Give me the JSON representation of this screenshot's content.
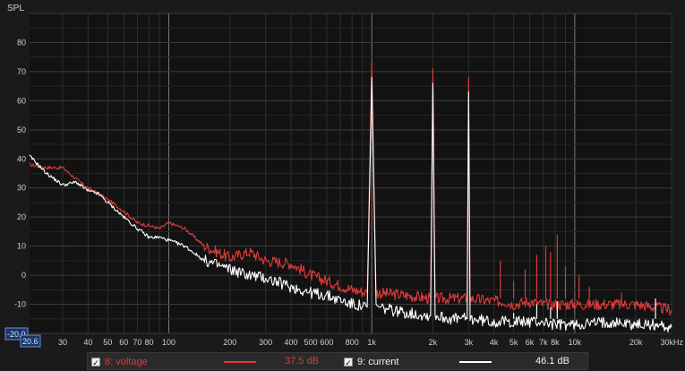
{
  "chart_data": {
    "type": "line",
    "ylabel": "SPL",
    "xlabel": "",
    "xscale": "log",
    "xlim": [
      20.6,
      30000
    ],
    "ylim": [
      -20,
      90
    ],
    "xaxis_min_label": "20.6",
    "yaxis_min_label": "-20.0",
    "ytick_labels": [
      "80",
      "70",
      "60",
      "50",
      "40",
      "30",
      "20",
      "10",
      "0",
      "-10"
    ],
    "yticks": [
      80,
      70,
      60,
      50,
      40,
      30,
      20,
      10,
      0,
      -10
    ],
    "xticks": [
      {
        "v": 30,
        "t": "30"
      },
      {
        "v": 40,
        "t": "40"
      },
      {
        "v": 50,
        "t": "50"
      },
      {
        "v": 60,
        "t": "60"
      },
      {
        "v": 70,
        "t": "70"
      },
      {
        "v": 80,
        "t": "80"
      },
      {
        "v": 100,
        "t": "100"
      },
      {
        "v": 200,
        "t": "200"
      },
      {
        "v": 300,
        "t": "300"
      },
      {
        "v": 400,
        "t": "400"
      },
      {
        "v": 500,
        "t": "500"
      },
      {
        "v": 600,
        "t": "600"
      },
      {
        "v": 800,
        "t": "800"
      },
      {
        "v": 1000,
        "t": "1k"
      },
      {
        "v": 2000,
        "t": "2k"
      },
      {
        "v": 3000,
        "t": "3k"
      },
      {
        "v": 4000,
        "t": "4k"
      },
      {
        "v": 5000,
        "t": "5k"
      },
      {
        "v": 6000,
        "t": "6k"
      },
      {
        "v": 7000,
        "t": "7k"
      },
      {
        "v": 8000,
        "t": "8k"
      },
      {
        "v": 10000,
        "t": "10k"
      },
      {
        "v": 20000,
        "t": "20k"
      },
      {
        "v": 30000,
        "t": "30kHz"
      }
    ],
    "grid": true,
    "legend_position": "bottom",
    "series": [
      {
        "name": "8: voltage",
        "color": "#e03a3a",
        "legend_value": "37.5 dB",
        "x": [
          20.6,
          25,
          30,
          35,
          40,
          45,
          50,
          60,
          70,
          80,
          90,
          100,
          120,
          150,
          200,
          250,
          300,
          400,
          500,
          600,
          800,
          950,
          1000,
          1050,
          1500,
          1950,
          2000,
          2050,
          2500,
          2950,
          3000,
          3050,
          4000,
          4500,
          5000,
          6000,
          7000,
          8000,
          10000,
          15000,
          20000,
          25000,
          30000
        ],
        "y": [
          38,
          37,
          37,
          33,
          30,
          28,
          26,
          22,
          18,
          17,
          16,
          18,
          16,
          10,
          6,
          8,
          5,
          4,
          0,
          -2,
          -5,
          -6,
          73,
          -6,
          -7,
          -8,
          71,
          -8,
          -8,
          -8,
          68,
          -8,
          -9,
          -9,
          -10,
          -9,
          -10,
          -10,
          -10,
          -10,
          -10,
          -11,
          -12
        ]
      },
      {
        "name": "9: current",
        "color": "#ffffff",
        "legend_value": "46.1 dB",
        "x": [
          20.6,
          25,
          30,
          35,
          40,
          45,
          50,
          60,
          70,
          80,
          90,
          100,
          120,
          150,
          200,
          250,
          300,
          400,
          500,
          600,
          800,
          950,
          1000,
          1050,
          1500,
          1950,
          2000,
          2050,
          2500,
          2950,
          3000,
          3050,
          4000,
          4500,
          5000,
          6000,
          7000,
          8000,
          10000,
          15000,
          20000,
          25000,
          30000
        ],
        "y": [
          41,
          35,
          31,
          32,
          29,
          28,
          25,
          20,
          16,
          13,
          13,
          12,
          10,
          5,
          2,
          0,
          -1,
          -4,
          -6,
          -7,
          -10,
          -11,
          68,
          -11,
          -13,
          -14,
          66,
          -14,
          -15,
          -15,
          63,
          -15,
          -16,
          -16,
          -16,
          -16,
          -16,
          -17,
          -17,
          -16,
          -17,
          -17,
          -18
        ]
      }
    ],
    "harmonic_spurs_voltage": [
      {
        "x": 4300,
        "y": 5
      },
      {
        "x": 5000,
        "y": -2
      },
      {
        "x": 5700,
        "y": 2
      },
      {
        "x": 6500,
        "y": 7
      },
      {
        "x": 7200,
        "y": 10
      },
      {
        "x": 7600,
        "y": 8
      },
      {
        "x": 8200,
        "y": 14
      },
      {
        "x": 9000,
        "y": 3
      },
      {
        "x": 10500,
        "y": 0
      },
      {
        "x": 11800,
        "y": -4
      },
      {
        "x": 17000,
        "y": -6
      }
    ],
    "harmonic_spurs_current": [
      {
        "x": 5000,
        "y": -13
      },
      {
        "x": 6500,
        "y": -10
      },
      {
        "x": 7600,
        "y": -11
      },
      {
        "x": 8200,
        "y": -9
      },
      {
        "x": 25000,
        "y": -8
      }
    ]
  },
  "legend": {
    "items": [
      {
        "label": "8: voltage",
        "value": "37.5 dB",
        "color": "#e03a3a",
        "checked": "✓"
      },
      {
        "label": "9: current",
        "value": "46.1 dB",
        "color": "#ffffff",
        "checked": "✓"
      }
    ]
  }
}
